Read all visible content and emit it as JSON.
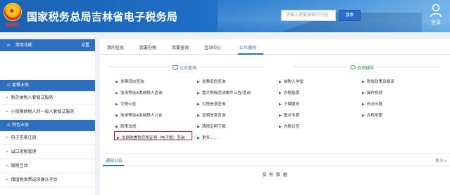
{
  "header": {
    "emblem_text": "国家税务",
    "site_title": "国家税务总局吉林省电子税务局",
    "search_placeholder": "请输入需要搜索的内容",
    "search_button": "搜索",
    "login_label": "登录",
    "colors": {
      "header_start": "#1c62b4",
      "header_end": "#6aaee6"
    }
  },
  "sidebar": {
    "common_func": {
      "label": "常用功能",
      "aux": "设置"
    },
    "sections": [
      {
        "title": "套餐业务",
        "items": [
          "新办纳税人套餐式服务",
          "小规模纳税人转一般人套餐式服务"
        ]
      },
      {
        "title": "特色业务",
        "items": [
          "电子签章注册",
          "出口退税管理",
          "银税互动",
          "增值税发票选择确认平台"
        ]
      }
    ],
    "colors": {
      "section_bg": "#2f6fc0"
    }
  },
  "tabs": [
    {
      "label": "我的信息",
      "active": false
    },
    {
      "label": "我要办税",
      "active": false
    },
    {
      "label": "我要查询",
      "active": false
    },
    {
      "label": "互动中心",
      "active": false
    },
    {
      "label": "公众服务",
      "active": true
    }
  ],
  "public_query": {
    "title": "公众查询",
    "col1": [
      "发票流向查询",
      "信用等级A类纳税人查询",
      "欠税公告",
      "信用等级A类纳税人公告",
      "政策法规",
      "车辆购置税完税证明（电子版）查询"
    ],
    "col2": [
      "发票真伪查询",
      "重大税收违法案件公告/查询",
      "欠税信息查询",
      "证明信息查询",
      "清税证明下载",
      "更多……"
    ]
  },
  "consult": {
    "title": "咨询辅导",
    "col3": [
      "纳税人学堂",
      "办税指南",
      "下载服务",
      "重点专题",
      "办税日历"
    ],
    "col4": [
      "税收政策及解读",
      "操作视频",
      "热点问题",
      "办税地图"
    ]
  },
  "highlighted_link": "车辆购置税完税证明（电子版）查询",
  "notice": {
    "tab": "通知公告",
    "more": "更多>",
    "empty_text": "没 有 数 据"
  },
  "accent_color": "#2a6fcb",
  "green_color": "#2c9a3c",
  "highlight_color": "#e02020"
}
